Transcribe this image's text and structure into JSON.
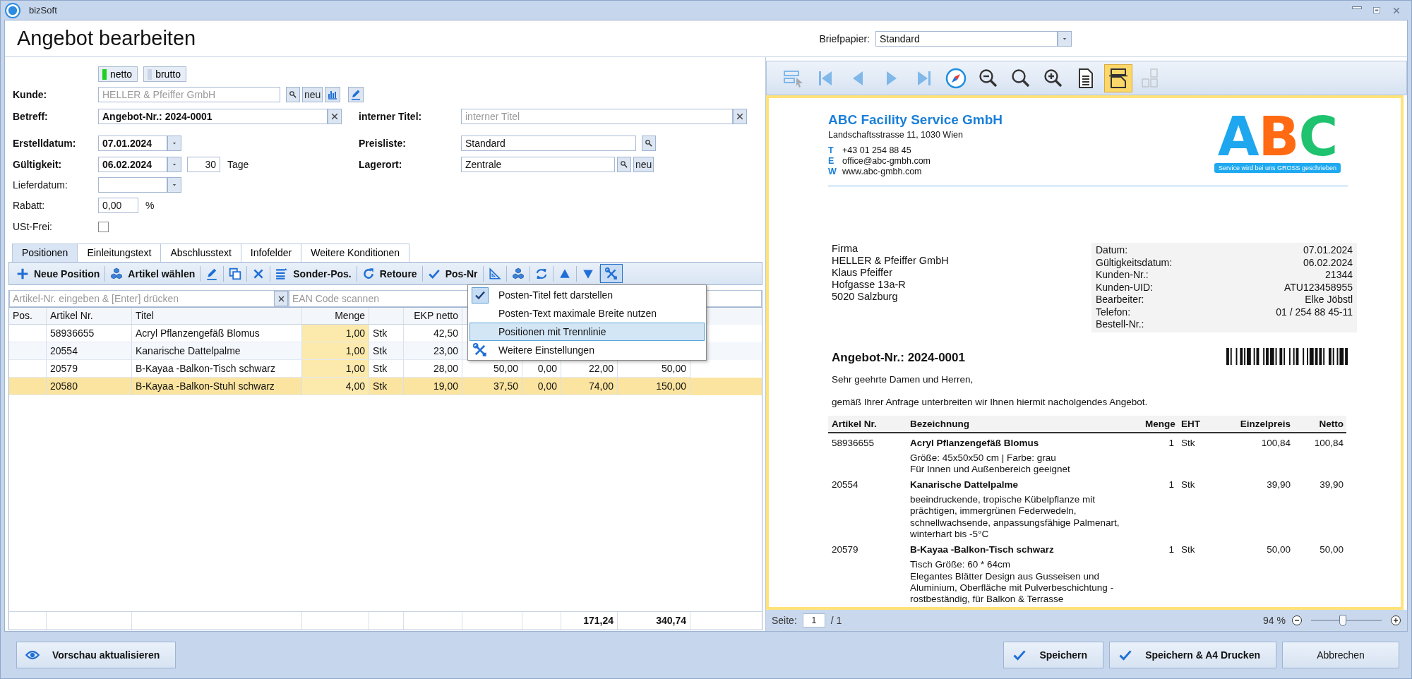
{
  "window": {
    "title": "bizSoft"
  },
  "header": {
    "title": "Angebot bearbeiten",
    "letterhead_label": "Briefpapier:",
    "letterhead_value": "Standard"
  },
  "price_mode": [
    {
      "label": "netto",
      "selected": true
    },
    {
      "label": "brutto",
      "selected": false
    }
  ],
  "form": {
    "customer": {
      "label": "Kunde:",
      "required": true,
      "value": "HELLER & Pfeiffer GmbH",
      "disabled": true,
      "new_label": "neu"
    },
    "subject": {
      "label": "Betreff:",
      "required": true,
      "value": "Angebot-Nr.: 2024-0001"
    },
    "internal_title": {
      "label": "interner Titel:",
      "required": true,
      "placeholder": "interner Titel"
    },
    "created": {
      "label": "Erstelldatum:",
      "required": true,
      "value": "07.01.2024"
    },
    "valid_until": {
      "label": "Gültigkeit:",
      "required": true,
      "value": "06.02.2024",
      "days": "30",
      "days_unit": "Tage"
    },
    "delivery": {
      "label": "Lieferdatum:",
      "required": false
    },
    "discount": {
      "label": "Rabatt:",
      "required": false,
      "value": "0,00",
      "unit": "%"
    },
    "tax_free": {
      "label": "USt-Frei:",
      "required": false,
      "checked": false
    },
    "price_list": {
      "label": "Preisliste:",
      "required": true,
      "value": "Standard"
    },
    "warehouse": {
      "label": "Lagerort:",
      "required": true,
      "value": "Zentrale",
      "new_label": "neu"
    }
  },
  "tabs": [
    {
      "label": "Positionen",
      "selected": true
    },
    {
      "label": "Einleitungstext",
      "selected": false
    },
    {
      "label": "Abschlusstext",
      "selected": false
    },
    {
      "label": "Infofelder",
      "selected": false
    },
    {
      "label": "Weitere Konditionen",
      "selected": false
    }
  ],
  "toolbar": [
    {
      "label": "Neue Position",
      "pressed": false
    },
    {
      "label": "Artikel wählen",
      "pressed": false
    },
    {
      "pressed": false
    },
    {
      "pressed": false
    },
    {
      "pressed": false
    },
    {
      "label": "Sonder-Pos.",
      "pressed": false
    },
    {
      "label": "Retoure",
      "pressed": false
    },
    {
      "label": "Pos-Nr",
      "pressed": false
    },
    {
      "pressed": false
    },
    {
      "pressed": false
    },
    {
      "pressed": false
    },
    {
      "pressed": false
    },
    {
      "pressed": false
    },
    {
      "pressed": true
    }
  ],
  "search": {
    "article_placeholder": "Artikel-Nr. eingeben & [Enter] drücken",
    "ean_placeholder": "EAN Code scannen"
  },
  "table": {
    "columns": [
      {
        "label": "Pos."
      },
      {
        "label": "Artikel Nr."
      },
      {
        "label": "Titel"
      },
      {
        "label": "Menge"
      },
      {},
      {
        "label": "EKP netto"
      },
      {},
      {},
      {},
      {}
    ],
    "rows": [
      {
        "selected": false,
        "cells": [
          null,
          "58936655",
          "Acryl Pflanzengefäß Blomus",
          "1,00",
          "Stk",
          "42,50"
        ]
      },
      {
        "selected": false,
        "cells": [
          null,
          "20554",
          "Kanarische Dattelpalme",
          "1,00",
          "Stk",
          "23,00"
        ]
      },
      {
        "selected": false,
        "cells": [
          null,
          "20579",
          "B-Kayaa -Balkon-Tisch schwarz",
          "1,00",
          "Stk",
          "28,00",
          "50,00",
          "0,00",
          "22,00",
          "50,00"
        ]
      },
      {
        "selected": true,
        "cells": [
          null,
          "20580",
          "B-Kayaa -Balkon-Stuhl schwarz",
          "4,00",
          "Stk",
          "19,00",
          "37,50",
          "0,00",
          "74,00",
          "150,00"
        ]
      }
    ],
    "totals": {
      "column_9": "171,24",
      "column_10": "340,74"
    }
  },
  "menu": {
    "items": [
      {
        "kind": "check",
        "label": "Posten-Titel fett darstellen",
        "checked": true,
        "highlighted": false
      },
      {
        "kind": "check",
        "label": "Posten-Text maximale Breite nutzen",
        "checked": false,
        "highlighted": false
      },
      {
        "kind": "check",
        "label": "Positionen mit Trennlinie",
        "checked": false,
        "highlighted": true
      },
      {
        "kind": "action",
        "label": "Weitere Einstellungen",
        "highlighted": false
      }
    ]
  },
  "preview_toolbar": [
    {
      "pressed": false,
      "disabled": true
    },
    {
      "pressed": false,
      "disabled": true
    },
    {
      "pressed": false,
      "disabled": true
    },
    {
      "pressed": false,
      "disabled": true
    },
    {
      "pressed": false,
      "disabled": true
    },
    {
      "pressed": false,
      "disabled": false
    },
    {
      "pressed": false,
      "disabled": false
    },
    {
      "pressed": false,
      "disabled": false
    },
    {
      "pressed": false,
      "disabled": false
    },
    {
      "pressed": false,
      "disabled": false
    },
    {
      "pressed": true,
      "disabled": false
    },
    {
      "pressed": false,
      "disabled": true
    }
  ],
  "preview": {
    "company": {
      "name": "ABC Facility Service  GmbH",
      "address": "Landschaftsstrasse 11, 1030 Wien",
      "contacts": [
        {
          "key": "T",
          "value": "+43 01 254 88 45"
        },
        {
          "key": "E",
          "value": "office@abc-gmbh.com"
        },
        {
          "key": "W",
          "value": "www.abc-gmbh.com"
        }
      ]
    },
    "logo": {
      "letters": [
        {
          "char": "A",
          "color": "#1ea7ef"
        },
        {
          "char": "B",
          "color": "#ff6a12"
        },
        {
          "char": "C",
          "color": "#1fc26e"
        }
      ],
      "tagline": "Service wird bei uns GROSS geschrieben"
    },
    "recipient": [
      "Firma",
      "HELLER & Pfeiffer GmbH",
      "Klaus Pfeiffer",
      "Hofgasse 13a-R",
      "5020 Salzburg"
    ],
    "info": [
      {
        "label": "Datum:",
        "value": "07.01.2024"
      },
      {
        "label": "Gültigkeitsdatum:",
        "value": "06.02.2024"
      },
      {
        "label": "Kunden-Nr.:",
        "value": "21344"
      },
      {
        "label": "Kunden-UID:",
        "value": "ATU123458955"
      },
      {
        "label": "Bearbeiter:",
        "value": "Elke Jöbstl"
      },
      {
        "label": "Telefon:",
        "value": "01 / 254 88 45-11"
      },
      {
        "label": "Bestell-Nr.:"
      }
    ],
    "title": "Angebot-Nr.: 2024-0001",
    "greeting": "Sehr geehrte Damen und Herren,",
    "intro": "gemäß Ihrer Anfrage unterbreiten wir Ihnen hiermit nacholgendes Angebot.",
    "columns": [
      "Artikel Nr.",
      "Bezeichnung",
      "Menge",
      "EHT",
      "Einzelpreis",
      "Netto"
    ],
    "items": [
      {
        "number": "58936655",
        "title": "Acryl Pflanzengefäß Blomus",
        "description": [
          "Größe: 45x50x50 cm | Farbe: grau",
          "Für Innen und Außenbereich geeignet"
        ],
        "quantity": "1",
        "unit": "Stk",
        "unit_price": "100,84",
        "net": "100,84"
      },
      {
        "number": "20554",
        "title": "Kanarische Dattelpalme",
        "description": [
          "beeindruckende, tropische Kübelpflanze mit",
          "prächtigen, immergrünen Federwedeln,",
          "schnellwachsende, anpassungsfähige Palmenart,",
          "winterhart bis -5°C"
        ],
        "quantity": "1",
        "unit": "Stk",
        "unit_price": "39,90",
        "net": "39,90"
      },
      {
        "number": "20579",
        "title": "B-Kayaa -Balkon-Tisch schwarz",
        "description": [
          "Tisch Größe: 60 * 64cm",
          "Elegantes Blätter Design aus Gusseisen und",
          "Aluminium, Oberfläche mit Pulverbeschichtung -",
          "rostbeständig, für Balkon & Terrasse"
        ],
        "quantity": "1",
        "unit": "Stk",
        "unit_price": "50,00",
        "net": "50,00"
      }
    ]
  },
  "status": {
    "page_label": "Seite:",
    "page": "1",
    "page_total": "/ 1",
    "zoom": "94 %",
    "zoom_slider": {
      "level": 0.45
    }
  },
  "buttons": [
    {
      "label": "Vorschau aktualisieren"
    },
    {
      "label": "Speichern"
    },
    {
      "label": "Speichern & A4 Drucken"
    },
    {
      "label": "Abbrechen"
    }
  ]
}
